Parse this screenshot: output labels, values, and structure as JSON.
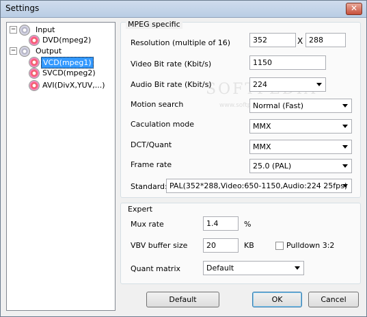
{
  "window": {
    "title": "Settings",
    "close_glyph": "✕"
  },
  "tree": {
    "input": {
      "label": "Input",
      "expander": "−",
      "children": [
        "DVD(mpeg2)"
      ]
    },
    "output": {
      "label": "Output",
      "expander": "−",
      "children": [
        "VCD(mpeg1)",
        "SVCD(mpeg2)",
        "AVI(DivX,YUV,...)"
      ]
    },
    "selected": "VCD(mpeg1)"
  },
  "mpeg": {
    "group_title": "MPEG specific",
    "resolution_label": "Resolution (multiple of 16)",
    "resolution_w": "352",
    "resolution_sep": "X",
    "resolution_h": "288",
    "video_bitrate_label": "Video Bit rate (Kbit/s)",
    "video_bitrate": "1150",
    "audio_bitrate_label": "Audio Bit rate (Kbit/s)",
    "audio_bitrate": "224",
    "motion_label": "Motion search",
    "motion": "Normal (Fast)",
    "calc_label": "Caculation mode",
    "calc": "MMX",
    "dct_label": "DCT/Quant",
    "dct": "MMX",
    "framerate_label": "Frame rate",
    "framerate": "25.0  (PAL)",
    "standard_label": "Standard:",
    "standard": "PAL(352*288,Video:650-1150,Audio:224 25fps)"
  },
  "expert": {
    "group_title": "Expert",
    "mux_label": "Mux rate",
    "mux": "1.4",
    "mux_unit": "%",
    "vbv_label": "VBV buffer size",
    "vbv": "20",
    "vbv_unit": "KB",
    "pulldown_label": "Pulldown 3:2",
    "pulldown_checked": false,
    "quant_label": "Quant matrix",
    "quant": "Default"
  },
  "buttons": {
    "default": "Default",
    "ok": "OK",
    "cancel": "Cancel"
  },
  "watermark": {
    "main": "SOFTPEDIA",
    "sub": "www.softpedia.com"
  }
}
